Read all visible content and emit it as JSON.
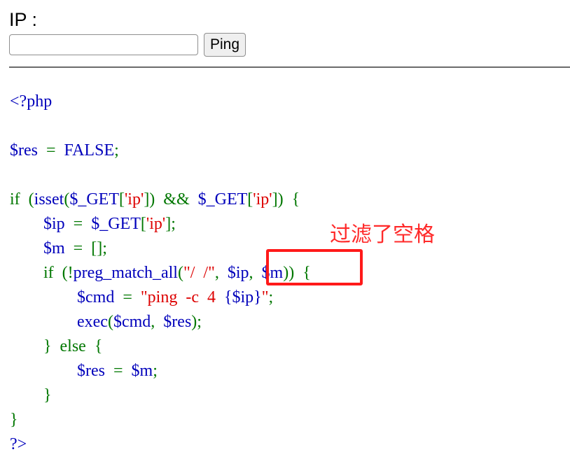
{
  "form": {
    "ip_label": "IP :",
    "ip_input_value": "",
    "ping_button_label": "Ping"
  },
  "code_lines": [
    [
      {
        "t": "<?php",
        "c": "vr"
      }
    ],
    [],
    [
      {
        "t": "$res",
        "c": "vr"
      },
      {
        "t": "  =  ",
        "c": "kw"
      },
      {
        "t": "FALSE",
        "c": "vr"
      },
      {
        "t": ";",
        "c": "kw"
      }
    ],
    [],
    [
      {
        "t": "if  (",
        "c": "kw"
      },
      {
        "t": "isset",
        "c": "vr"
      },
      {
        "t": "(",
        "c": "kw"
      },
      {
        "t": "$_GET",
        "c": "vr"
      },
      {
        "t": "[",
        "c": "kw"
      },
      {
        "t": "'ip'",
        "c": "st"
      },
      {
        "t": "])  &&  ",
        "c": "kw"
      },
      {
        "t": "$_GET",
        "c": "vr"
      },
      {
        "t": "[",
        "c": "kw"
      },
      {
        "t": "'ip'",
        "c": "st"
      },
      {
        "t": "])  {",
        "c": "kw"
      }
    ],
    [
      {
        "t": "        ",
        "c": "kw"
      },
      {
        "t": "$ip",
        "c": "vr"
      },
      {
        "t": "  =  ",
        "c": "kw"
      },
      {
        "t": "$_GET",
        "c": "vr"
      },
      {
        "t": "[",
        "c": "kw"
      },
      {
        "t": "'ip'",
        "c": "st"
      },
      {
        "t": "];",
        "c": "kw"
      }
    ],
    [
      {
        "t": "        ",
        "c": "kw"
      },
      {
        "t": "$m",
        "c": "vr"
      },
      {
        "t": "  =  [];",
        "c": "kw"
      }
    ],
    [
      {
        "t": "        if  (!",
        "c": "kw"
      },
      {
        "t": "preg_match_all",
        "c": "vr"
      },
      {
        "t": "(",
        "c": "kw"
      },
      {
        "t": "\"/  /\"",
        "c": "st"
      },
      {
        "t": ",  ",
        "c": "kw"
      },
      {
        "t": "$ip",
        "c": "vr"
      },
      {
        "t": ",  ",
        "c": "kw"
      },
      {
        "t": "$m",
        "c": "vr"
      },
      {
        "t": "))  {",
        "c": "kw"
      }
    ],
    [
      {
        "t": "                ",
        "c": "kw"
      },
      {
        "t": "$cmd",
        "c": "vr"
      },
      {
        "t": "  =  ",
        "c": "kw"
      },
      {
        "t": "\"ping  -c  4  ",
        "c": "st"
      },
      {
        "t": "{$ip}",
        "c": "vr"
      },
      {
        "t": "\"",
        "c": "st"
      },
      {
        "t": ";",
        "c": "kw"
      }
    ],
    [
      {
        "t": "                ",
        "c": "kw"
      },
      {
        "t": "exec",
        "c": "vr"
      },
      {
        "t": "(",
        "c": "kw"
      },
      {
        "t": "$cmd",
        "c": "vr"
      },
      {
        "t": ",  ",
        "c": "kw"
      },
      {
        "t": "$res",
        "c": "vr"
      },
      {
        "t": ");",
        "c": "kw"
      }
    ],
    [
      {
        "t": "        }  else  {",
        "c": "kw"
      }
    ],
    [
      {
        "t": "                ",
        "c": "kw"
      },
      {
        "t": "$res",
        "c": "vr"
      },
      {
        "t": "  =  ",
        "c": "kw"
      },
      {
        "t": "$m",
        "c": "vr"
      },
      {
        "t": ";",
        "c": "kw"
      }
    ],
    [
      {
        "t": "        }",
        "c": "kw"
      }
    ],
    [
      {
        "t": "}",
        "c": "kw"
      }
    ],
    [
      {
        "t": "?>",
        "c": "vr"
      }
    ]
  ],
  "annotation": {
    "text": "过滤了空格",
    "color": "#ff2a2a"
  },
  "colors": {
    "keyword": "#007700",
    "string": "#dd0000",
    "variable": "#0000bb",
    "highlight_box": "#ff1a1a"
  }
}
